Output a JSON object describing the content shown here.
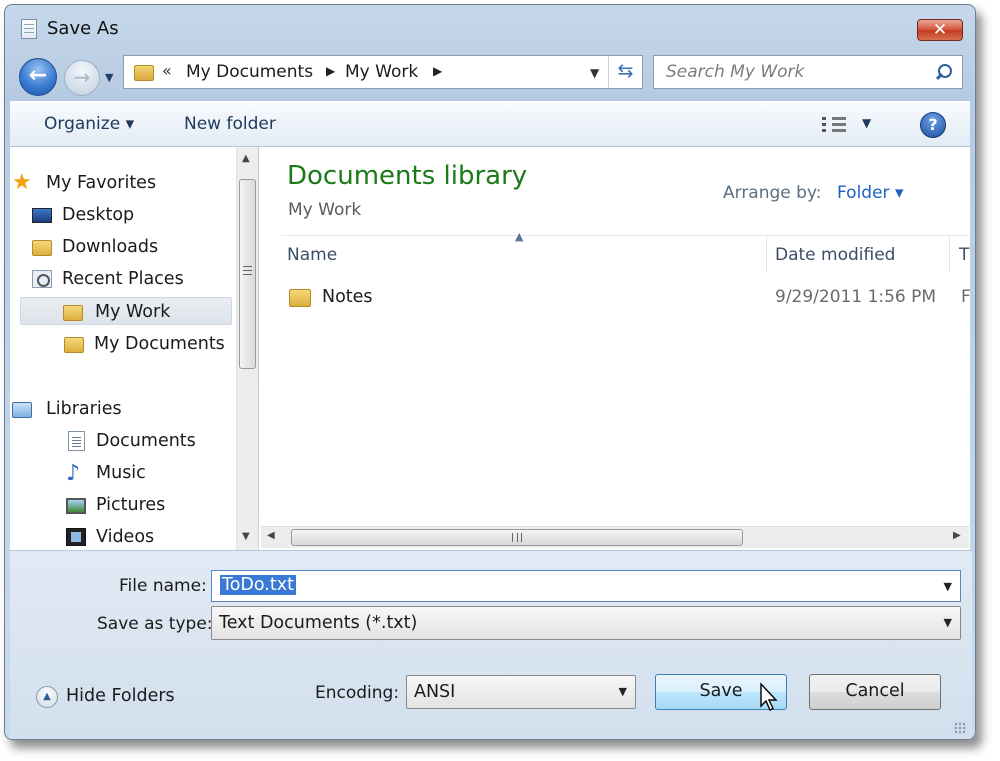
{
  "window": {
    "title": "Save As",
    "close_label": "✕"
  },
  "nav": {
    "back_label": "←",
    "forward_label": "→",
    "breadcrumb_overflow": "«",
    "breadcrumbs": [
      "My Documents",
      "My Work"
    ],
    "search_placeholder": "Search My Work"
  },
  "toolbar": {
    "organize_label": "Organize ▾",
    "new_folder_label": "New folder",
    "help_label": "?"
  },
  "sidebar": {
    "favorites_label": "My Favorites",
    "favorites": [
      "Desktop",
      "Downloads",
      "Recent Places",
      "My Work",
      "My Documents"
    ],
    "selected": "My Work",
    "libraries_label": "Libraries",
    "libraries": [
      "Documents",
      "Music",
      "Pictures",
      "Videos"
    ]
  },
  "content": {
    "library_title": "Documents library",
    "library_subtitle": "My Work",
    "arrange_label": "Arrange by:",
    "arrange_value": "Folder ▾",
    "columns": {
      "name": "Name",
      "date": "Date modified",
      "type": "T"
    },
    "files": [
      {
        "name": "Notes",
        "date": "9/29/2011 1:56 PM",
        "type": "F"
      }
    ]
  },
  "form": {
    "file_name_label": "File name:",
    "file_name_value": "ToDo.txt",
    "save_type_label": "Save as type:",
    "save_type_value": "Text Documents (*.txt)",
    "encoding_label": "Encoding:",
    "encoding_value": "ANSI",
    "hide_folders_label": "Hide Folders",
    "save_label": "Save",
    "cancel_label": "Cancel"
  },
  "colors": {
    "library_title": "#1c7a18",
    "accent_link": "#1d62c2",
    "selection": "#3a79d6"
  }
}
